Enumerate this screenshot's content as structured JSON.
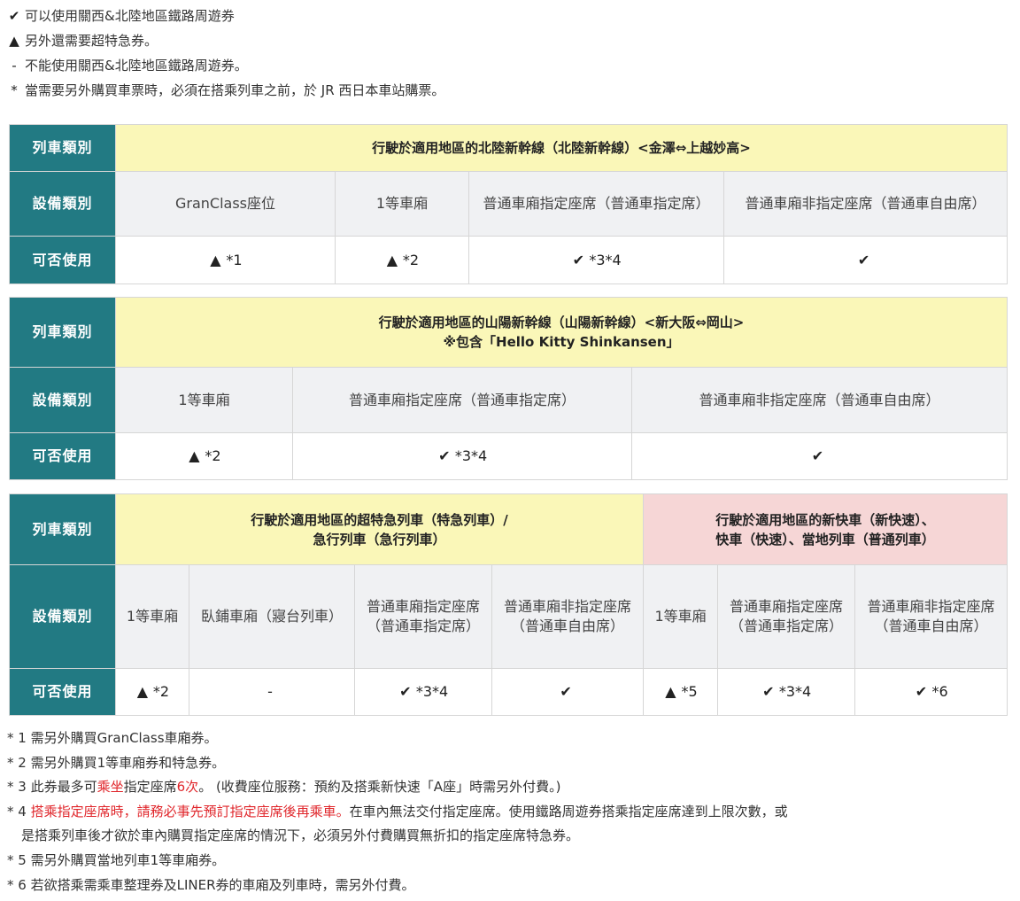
{
  "legend": [
    {
      "icon": "check",
      "text": "可以使用關西&北陸地區鐵路周遊券"
    },
    {
      "icon": "triangle",
      "text": "另外還需要超特急券。"
    },
    {
      "icon": "dash",
      "text": "不能使用關西&北陸地區鐵路周遊券。"
    },
    {
      "icon": "asterisk",
      "text": "當需要另外購買車票時，必須在搭乘列車之前，於 JR 西日本車站購票。"
    }
  ],
  "icons": {
    "check": "✔",
    "triangle": "▲",
    "dash": "-",
    "asterisk": "*"
  },
  "labels": {
    "train_type": "列車類別",
    "facility_type": "設備類別",
    "usable": "可否使用"
  },
  "tables": [
    {
      "heads": [
        {
          "lines": [
            "行駛於適用地區的北陸新幹線（北陸新幹線）<金澤⇔上越妙高>"
          ],
          "span": 4,
          "color": "yellow"
        }
      ],
      "facilities": [
        "GranClass座位",
        "1等車廂",
        "普通車廂指定座席（普通車指定席）",
        "普通車廂非指定座席（普通車自由席）"
      ],
      "usage": [
        {
          "icon": "triangle",
          "note": "*1"
        },
        {
          "icon": "triangle",
          "note": "*2"
        },
        {
          "icon": "check",
          "note": "*3*4"
        },
        {
          "icon": "check",
          "note": ""
        }
      ]
    },
    {
      "heads": [
        {
          "lines": [
            "行駛於適用地區的山陽新幹線（山陽新幹線）<新大阪⇔岡山>",
            "※包含「Hello Kitty Shinkansen」"
          ],
          "span": 3,
          "color": "yellow"
        }
      ],
      "facilities": [
        "1等車廂",
        "普通車廂指定座席（普通車指定席）",
        "普通車廂非指定座席（普通車自由席）"
      ],
      "usage": [
        {
          "icon": "triangle",
          "note": "*2"
        },
        {
          "icon": "check",
          "note": "*3*4"
        },
        {
          "icon": "check",
          "note": ""
        }
      ]
    },
    {
      "heads": [
        {
          "lines": [
            "行駛於適用地區的超特急列車（特急列車）/",
            "急行列車（急行列車）"
          ],
          "span": 4,
          "color": "yellow"
        },
        {
          "lines": [
            "行駛於適用地區的新快車（新快速）、",
            "快車（快速）、當地列車（普通列車）"
          ],
          "span": 3,
          "color": "pink"
        }
      ],
      "facilities": [
        "1等車廂",
        "臥鋪車廂（寢台列車）",
        "普通車廂指定座席（普通車指定席）",
        "普通車廂非指定座席（普通車自由席）",
        "1等車廂",
        "普通車廂指定座席（普通車指定席）",
        "普通車廂非指定座席（普通車自由席）"
      ],
      "usage": [
        {
          "icon": "triangle",
          "note": "*2"
        },
        {
          "icon": "dash",
          "note": ""
        },
        {
          "icon": "check",
          "note": "*3*4"
        },
        {
          "icon": "check",
          "note": ""
        },
        {
          "icon": "triangle",
          "note": "*5"
        },
        {
          "icon": "check",
          "note": "*3*4"
        },
        {
          "icon": "check",
          "note": "*6"
        }
      ]
    }
  ],
  "footnotes": [
    {
      "mark": "* 1",
      "segments": [
        {
          "text": "需另外購買GranClass車廂券。",
          "red": false
        }
      ]
    },
    {
      "mark": "* 2",
      "segments": [
        {
          "text": "需另外購買1等車廂券和特急券。",
          "red": false
        }
      ]
    },
    {
      "mark": "* 3",
      "segments": [
        {
          "text": "此券最多可",
          "red": false
        },
        {
          "text": "乘坐",
          "red": true
        },
        {
          "text": "指定座席",
          "red": false
        },
        {
          "text": "6次",
          "red": true
        },
        {
          "text": "。 (收費座位服務：預約及搭乘新快速「A座」時需另外付費。)",
          "red": false
        }
      ]
    },
    {
      "mark": "* 4",
      "segments": [
        {
          "text": "搭乘指定座席時，請務必事先預訂指定座席後再乘車。",
          "red": true
        },
        {
          "text": "在車內無法交付指定座席。使用鐵路周遊券搭乘指定座席達到上限次數，或",
          "red": false
        }
      ],
      "continuation": "是搭乘列車後才欲於車內購買指定座席的情況下，必須另外付費購買無折扣的指定座席特急券。"
    },
    {
      "mark": "* 5",
      "segments": [
        {
          "text": "需另外購買當地列車1等車廂券。",
          "red": false
        }
      ]
    },
    {
      "mark": "* 6",
      "segments": [
        {
          "text": "若欲搭乘需乘車整理券及LINER券的車廂及列車時，需另外付費。",
          "red": false
        }
      ]
    }
  ]
}
